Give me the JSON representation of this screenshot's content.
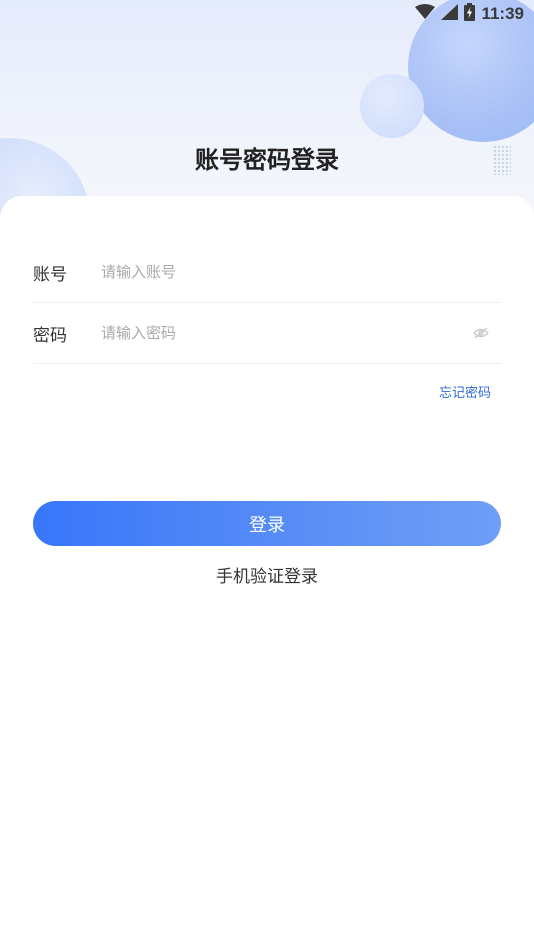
{
  "status_bar": {
    "time": "11:39",
    "icons": [
      "wifi-icon",
      "cellular-signal-icon",
      "battery-charging-icon"
    ]
  },
  "page": {
    "title": "账号密码登录"
  },
  "form": {
    "account": {
      "label": "账号",
      "value": "",
      "placeholder": "请输入账号"
    },
    "password": {
      "label": "密码",
      "value": "",
      "placeholder": "请输入密码",
      "toggle_icon": "eye-hidden-icon"
    },
    "forgot_password": "忘记密码",
    "login_button": "登录",
    "phone_login": "手机验证登录"
  },
  "colors": {
    "accent": "#3876fa",
    "link": "#2f6bd8",
    "title": "#222222",
    "placeholder": "#a9a9a9"
  }
}
